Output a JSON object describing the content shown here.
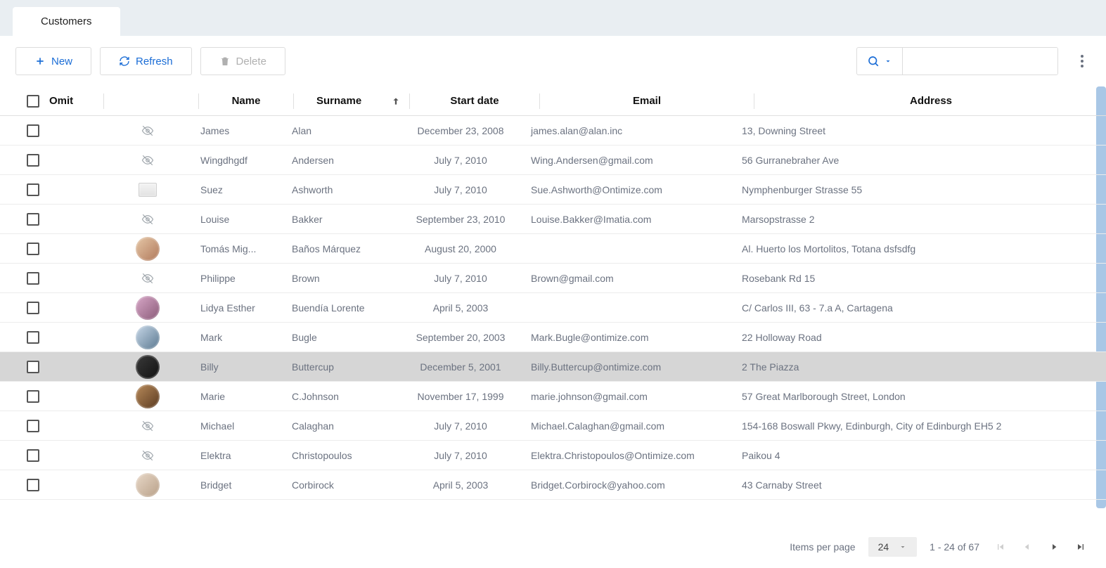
{
  "tab": {
    "label": "Customers"
  },
  "toolbar": {
    "new_label": "New",
    "refresh_label": "Refresh",
    "delete_label": "Delete"
  },
  "search": {
    "placeholder": ""
  },
  "columns": {
    "omit": "Omit",
    "name": "Name",
    "surname": "Surname",
    "startdate": "Start date",
    "email": "Email",
    "address": "Address"
  },
  "rows": [
    {
      "avatar": "eye-off",
      "name": "James",
      "surname": "Alan",
      "startdate": "December 23, 2008",
      "email": "james.alan@alan.inc",
      "address": "13, Downing Street",
      "highlight": false
    },
    {
      "avatar": "eye-off",
      "name": "Wingdhgdf",
      "surname": "Andersen",
      "startdate": "July 7, 2010",
      "email": "Wing.Andersen@gmail.com",
      "address": "56 Gurranebraher Ave",
      "highlight": false
    },
    {
      "avatar": "thumb",
      "name": "Suez",
      "surname": "Ashworth",
      "startdate": "July 7, 2010",
      "email": "Sue.Ashworth@Ontimize.com",
      "address": "Nymphenburger Strasse 55",
      "highlight": false
    },
    {
      "avatar": "eye-off",
      "name": "Louise",
      "surname": "Bakker",
      "startdate": "September 23, 2010",
      "email": "Louise.Bakker@Imatia.com",
      "address": "Marsopstrasse 2",
      "highlight": false
    },
    {
      "avatar": "photo",
      "name": "Tomás Mig...",
      "surname": "Baños Márquez",
      "startdate": "August 20, 2000",
      "email": "",
      "address": "Al. Huerto los Mortolitos, Totana dsfsdfg",
      "highlight": false
    },
    {
      "avatar": "eye-off",
      "name": "Philippe",
      "surname": "Brown",
      "startdate": "July 7, 2010",
      "email": "Brown@gmail.com",
      "address": "Rosebank Rd 15",
      "highlight": false
    },
    {
      "avatar": "photo",
      "name": "Lidya Esther",
      "surname": "Buendía Lorente",
      "startdate": "April 5, 2003",
      "email": "",
      "address": "C/ Carlos III, 63 - 7.a A, Cartagena",
      "highlight": false
    },
    {
      "avatar": "photo",
      "name": "Mark",
      "surname": "Bugle",
      "startdate": "September 20, 2003",
      "email": "Mark.Bugle@ontimize.com",
      "address": "22 Holloway Road",
      "highlight": false
    },
    {
      "avatar": "photo",
      "name": "Billy",
      "surname": "Buttercup",
      "startdate": "December 5, 2001",
      "email": "Billy.Buttercup@ontimize.com",
      "address": "2 The Piazza",
      "highlight": true
    },
    {
      "avatar": "photo",
      "name": "Marie",
      "surname": "C.Johnson",
      "startdate": "November 17, 1999",
      "email": "marie.johnson@gmail.com",
      "address": "57 Great Marlborough Street, London",
      "highlight": false
    },
    {
      "avatar": "eye-off",
      "name": "Michael",
      "surname": "Calaghan",
      "startdate": "July 7, 2010",
      "email": "Michael.Calaghan@gmail.com",
      "address": "154-168 Boswall Pkwy, Edinburgh, City of Edinburgh EH5 2",
      "highlight": false
    },
    {
      "avatar": "eye-off",
      "name": "Elektra",
      "surname": "Christopoulos",
      "startdate": "July 7, 2010",
      "email": "Elektra.Christopoulos@Ontimize.com",
      "address": "Paikou 4",
      "highlight": false
    },
    {
      "avatar": "photo",
      "name": "Bridget",
      "surname": "Corbirock",
      "startdate": "April 5, 2003",
      "email": "Bridget.Corbirock@yahoo.com",
      "address": "43 Carnaby Street",
      "highlight": false
    }
  ],
  "footer": {
    "items_per_page_label": "Items per page",
    "page_size": "24",
    "range": "1 - 24 of 67"
  }
}
